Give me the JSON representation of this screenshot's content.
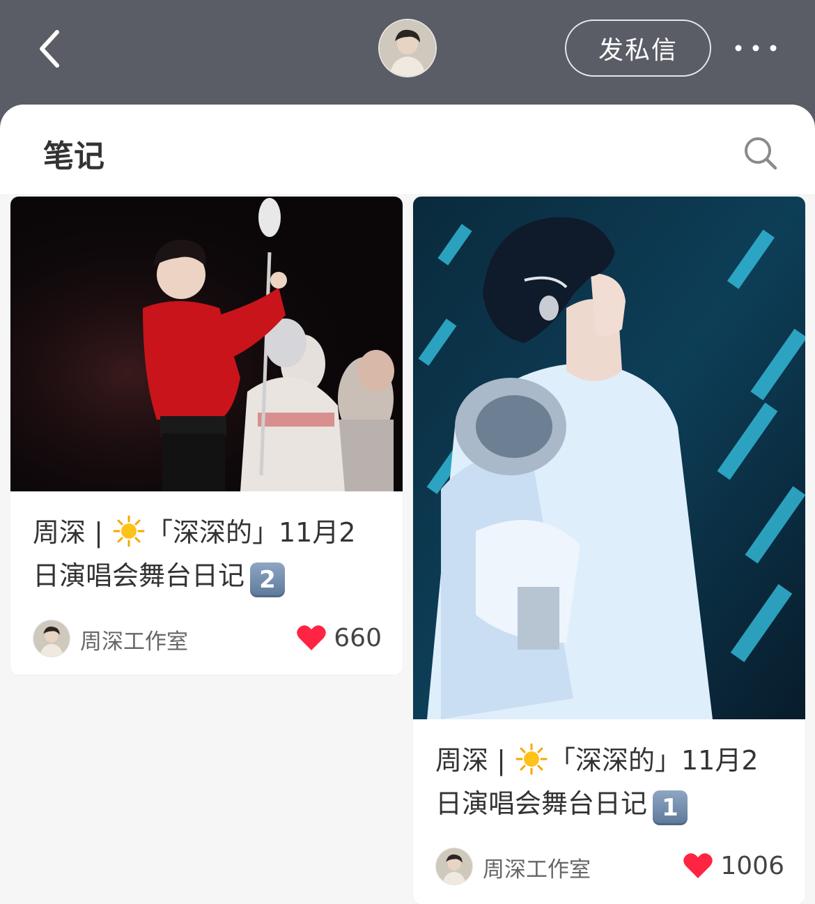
{
  "header": {
    "back_icon": "chevron-left-icon",
    "avatar_label": "",
    "dm_button_label": "发私信",
    "more_icon": "ellipsis-icon"
  },
  "sheet": {
    "title": "笔记",
    "search_icon": "search-icon"
  },
  "notes": [
    {
      "title_prefix": "周深 | ",
      "title_emoji": "sun-emoji",
      "title_main": "「深深的」11月2日演唱会舞台日记",
      "title_badge": "2",
      "author": "周深工作室",
      "likes": "660"
    },
    {
      "title_prefix": "周深 | ",
      "title_emoji": "sun-emoji",
      "title_main": "「深深的」11月2日演唱会舞台日记",
      "title_badge": "1",
      "author": "周深工作室",
      "likes": "1006"
    }
  ],
  "colors": {
    "header_bg": "#5a5d66",
    "like_red": "#ff2442",
    "title_text": "#333333"
  }
}
